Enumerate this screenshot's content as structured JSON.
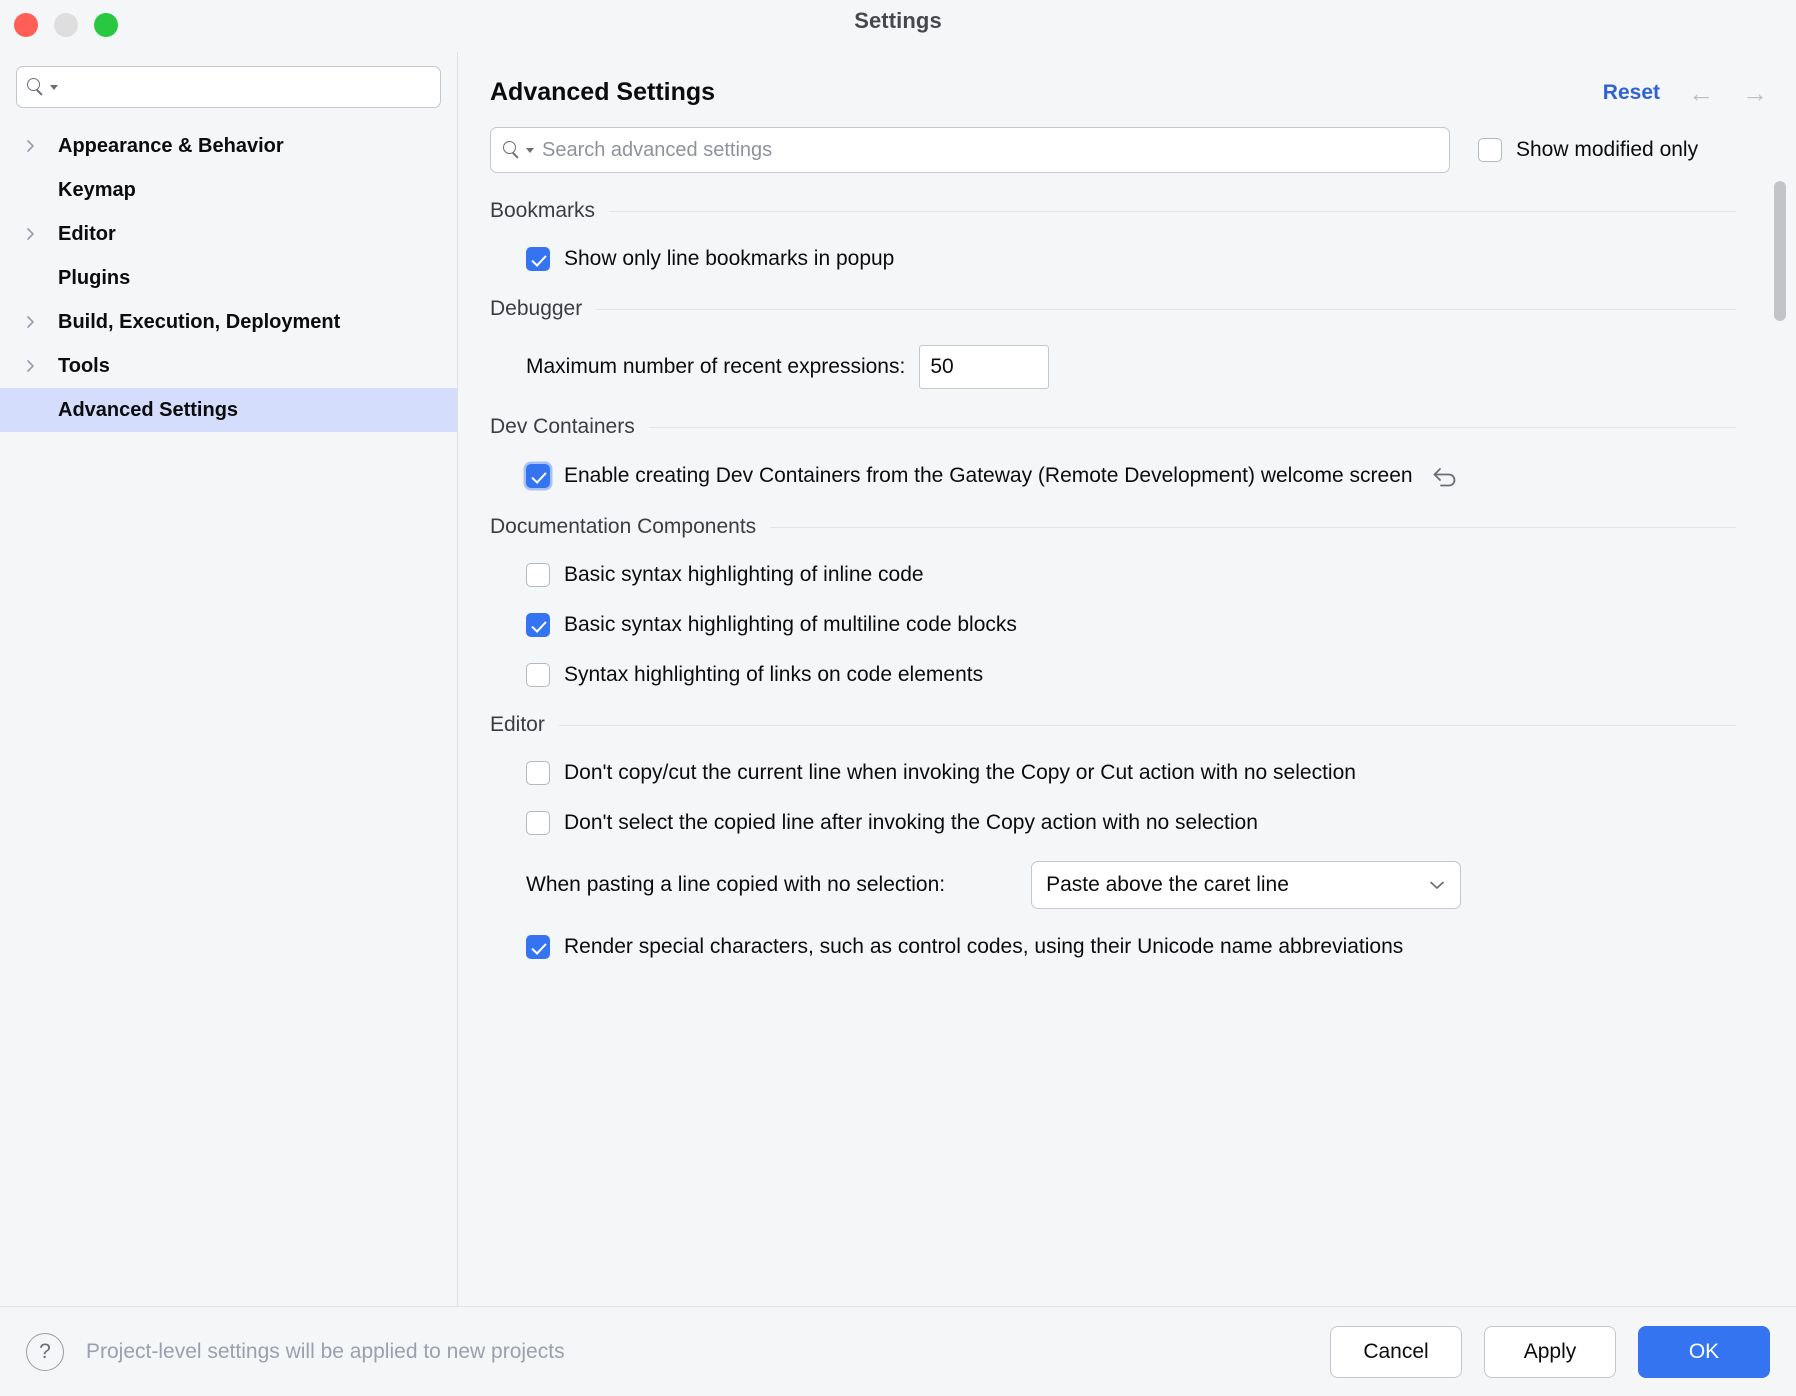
{
  "window": {
    "title": "Settings",
    "traffic_lights": [
      "close-button",
      "minimize-button",
      "zoom-button"
    ]
  },
  "sidebar": {
    "search": {
      "value": "",
      "placeholder": ""
    },
    "items": [
      {
        "label": "Appearance & Behavior",
        "expandable": true,
        "selected": false
      },
      {
        "label": "Keymap",
        "expandable": false,
        "selected": false
      },
      {
        "label": "Editor",
        "expandable": true,
        "selected": false
      },
      {
        "label": "Plugins",
        "expandable": false,
        "selected": false
      },
      {
        "label": "Build, Execution, Deployment",
        "expandable": true,
        "selected": false
      },
      {
        "label": "Tools",
        "expandable": true,
        "selected": false
      },
      {
        "label": "Advanced Settings",
        "expandable": false,
        "selected": true
      }
    ]
  },
  "header": {
    "title": "Advanced Settings",
    "reset_label": "Reset",
    "back_arrow": "←",
    "forward_arrow": "→"
  },
  "filter": {
    "search_placeholder": "Search advanced settings",
    "search_value": "",
    "show_modified_label": "Show modified only",
    "show_modified_checked": false
  },
  "groups": [
    {
      "title": "Bookmarks",
      "options": [
        {
          "kind": "checkbox",
          "label": "Show only line bookmarks in popup",
          "checked": true,
          "focused": false,
          "revert": false
        }
      ]
    },
    {
      "title": "Debugger",
      "options": [
        {
          "kind": "number",
          "label": "Maximum number of recent expressions:",
          "value": "50"
        }
      ]
    },
    {
      "title": "Dev Containers",
      "options": [
        {
          "kind": "checkbox",
          "label": "Enable creating Dev Containers from the Gateway (Remote Development) welcome screen",
          "checked": true,
          "focused": true,
          "revert": true
        }
      ]
    },
    {
      "title": "Documentation Components",
      "options": [
        {
          "kind": "checkbox",
          "label": "Basic syntax highlighting of inline code",
          "checked": false,
          "focused": false,
          "revert": false
        },
        {
          "kind": "checkbox",
          "label": "Basic syntax highlighting of multiline code blocks",
          "checked": true,
          "focused": false,
          "revert": false
        },
        {
          "kind": "checkbox",
          "label": "Syntax highlighting of links on code elements",
          "checked": false,
          "focused": false,
          "revert": false
        }
      ]
    },
    {
      "title": "Editor",
      "options": [
        {
          "kind": "checkbox",
          "label": "Don't copy/cut the current line when invoking the Copy or Cut action with no selection",
          "checked": false,
          "focused": false,
          "revert": false
        },
        {
          "kind": "checkbox",
          "label": "Don't select the copied line after invoking the Copy action with no selection",
          "checked": false,
          "focused": false,
          "revert": false
        },
        {
          "kind": "select",
          "label": "When pasting a line copied with no selection:",
          "value": "Paste above the caret line"
        },
        {
          "kind": "checkbox",
          "label": "Render special characters, such as control codes, using their Unicode name abbreviations",
          "checked": true,
          "focused": false,
          "revert": false
        }
      ]
    }
  ],
  "footer": {
    "help_glyph": "?",
    "note": "Project-level settings will be applied to new projects",
    "cancel_label": "Cancel",
    "apply_label": "Apply",
    "ok_label": "OK"
  },
  "colors": {
    "accent": "#3574f0",
    "link": "#3062d3",
    "selection": "#d4ddfb",
    "window_bg": "#f5f6f8"
  }
}
